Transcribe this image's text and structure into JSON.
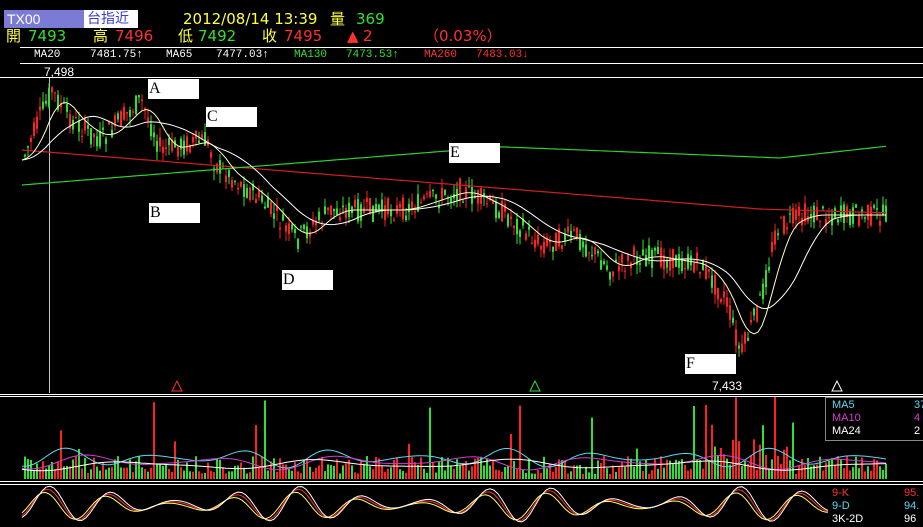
{
  "header": {
    "symbol": "TX00",
    "type_label": "台指近",
    "datetime": "2012/08/14 13:39",
    "volume_label": "量",
    "volume_value": "369",
    "open_label": "開",
    "open_value": "7493",
    "high_label": "高",
    "high_value": "7496",
    "low_label": "低",
    "low_value": "7492",
    "close_label": "收",
    "close_value": "7495",
    "change_value": "2",
    "change_pct": "（0.03%）"
  },
  "ma_bar": {
    "ma20_label": "MA20",
    "ma20_value": "7481.75↑",
    "ma65_label": "MA65",
    "ma65_value": "7477.03↑",
    "ma130_label": "MA130",
    "ma130_value": "7473.53↑",
    "ma260_label": "MA260",
    "ma260_value": "7483.03↓"
  },
  "price_panel": {
    "high_mark": "7,498",
    "low_mark": "7,433",
    "labels": [
      "A",
      "B",
      "C",
      "D",
      "E",
      "F"
    ]
  },
  "volume_panel": {
    "legend": [
      {
        "name": "MA5",
        "value": "37",
        "color": "#5ad8f0"
      },
      {
        "name": "MA10",
        "value": "4",
        "color": "#d040d0"
      },
      {
        "name": "MA24",
        "value": "2",
        "color": "#ffffff"
      }
    ]
  },
  "kd_panel": {
    "legend": [
      {
        "name": "9-K",
        "value": "95.",
        "color": "#ff3030"
      },
      {
        "name": "9-D",
        "value": "94.",
        "color": "#5ad8f0"
      },
      {
        "name": "3K-2D",
        "value": "96",
        "color": "#ffffff"
      }
    ]
  },
  "colors": {
    "up": "#ff2020",
    "down": "#30e030",
    "ma20": "#ffffc0",
    "ma65": "#ffffff",
    "ma130": "#30d030",
    "ma260": "#d02020"
  }
}
